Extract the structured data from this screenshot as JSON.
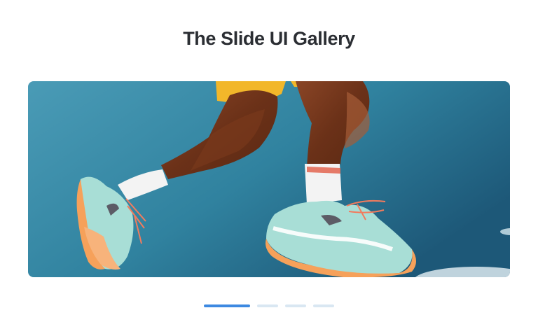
{
  "gallery": {
    "title": "The Slide UI Gallery",
    "slide_count": 4,
    "active_slide": 1
  },
  "slide": {
    "image_alt": "Runner's legs mid-stride wearing mint and orange running shoes against a blue sky"
  },
  "colors": {
    "active_dot": "#3d89e1",
    "inactive_dot": "#d9e7f2",
    "sky_top": "#1d5878",
    "sky_bottom": "#4a9bb6"
  }
}
